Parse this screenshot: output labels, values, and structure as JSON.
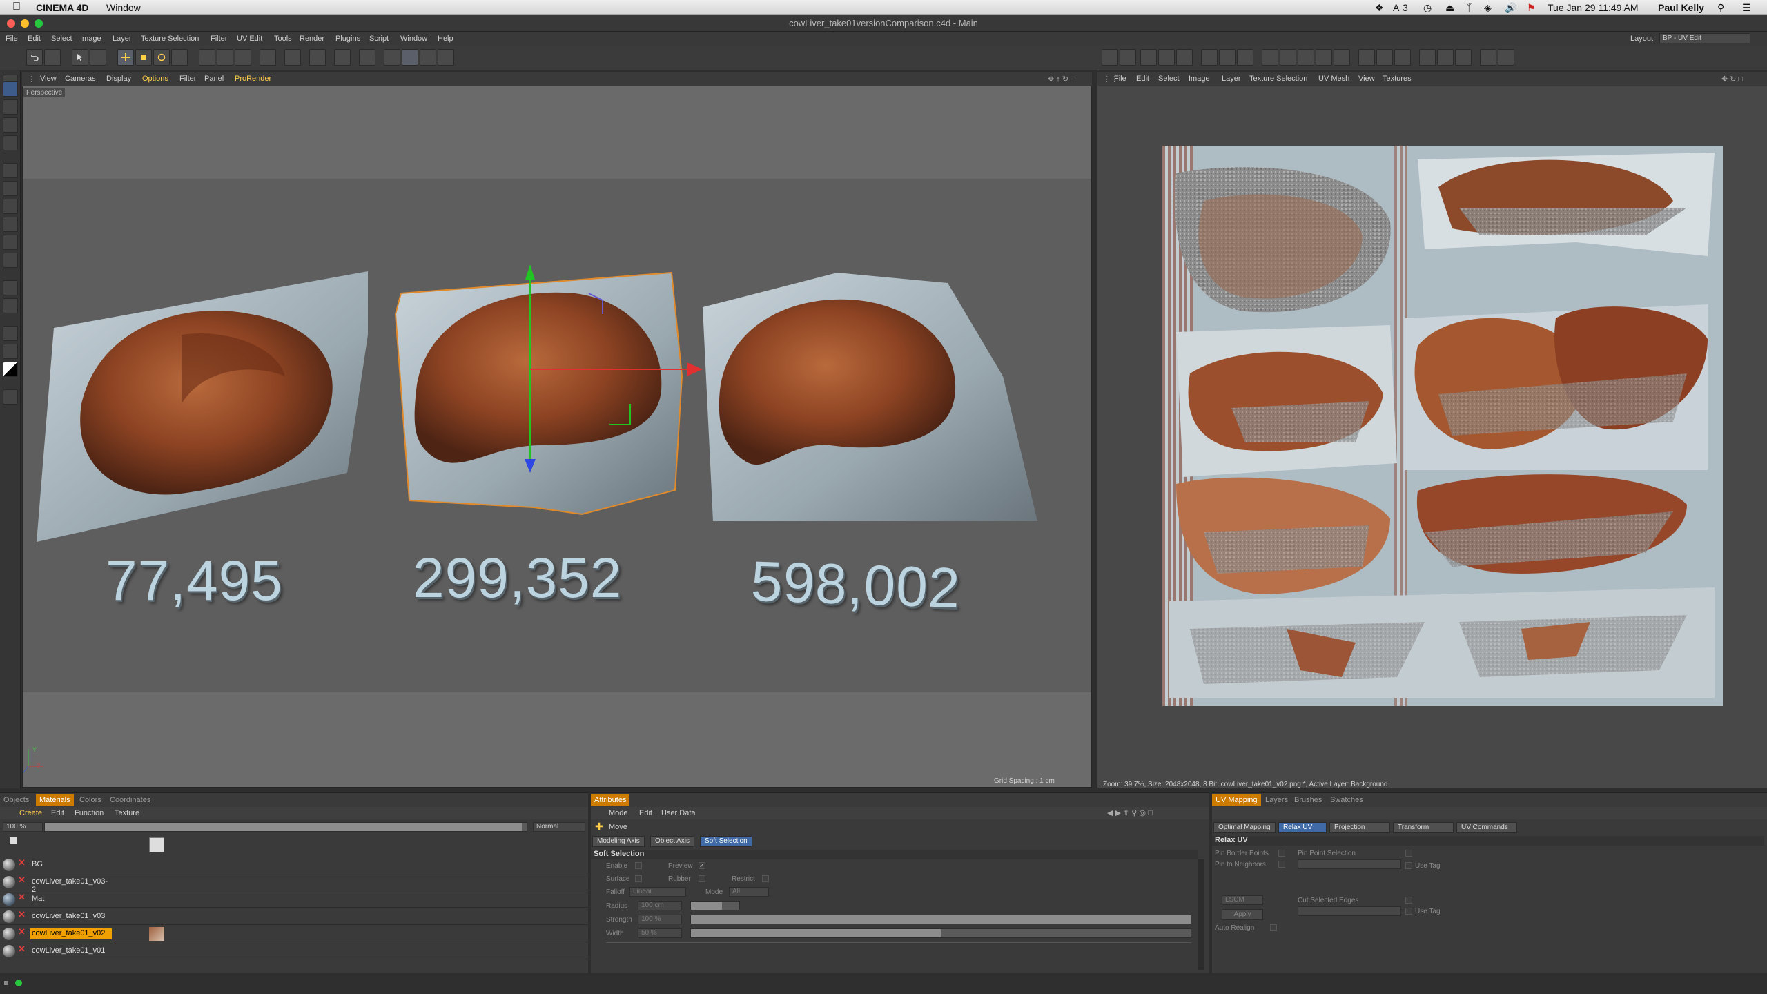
{
  "menubar": {
    "app": "CINEMA 4D",
    "window": "Window",
    "status_num": "3",
    "date_time": "Tue Jan 29  11:49 AM",
    "user": "Paul Kelly"
  },
  "titlebar": {
    "title": "cowLiver_take01versionComparison.c4d - Main"
  },
  "app_menu": [
    "File",
    "Edit",
    "Select",
    "Image",
    "Layer",
    "Texture Selection",
    "Filter",
    "UV Edit",
    "Tools",
    "Render",
    "Plugins",
    "Script",
    "Window",
    "Help"
  ],
  "layout": {
    "label": "Layout:",
    "value": "BP - UV Edit"
  },
  "viewport": {
    "menu": [
      "View",
      "Cameras",
      "Display",
      "Options",
      "Filter",
      "Panel",
      "ProRender"
    ],
    "label": "Perspective",
    "counts": [
      "77,495",
      "299,352",
      "598,002"
    ],
    "grid_spacing": "Grid Spacing : 1 cm",
    "axis_y": "Y",
    "axis_z": "Z"
  },
  "uv_view": {
    "menu": [
      "File",
      "Edit",
      "Select",
      "Image",
      "Layer",
      "Texture Selection",
      "UV Mesh",
      "View",
      "Textures"
    ],
    "status": "Zoom: 39.7%, Size: 2048x2048, 8 Bit, cowLiver_take01_v02.png *, Active Layer: Background"
  },
  "materials_panel": {
    "tabs": [
      "Objects",
      "Materials",
      "Colors",
      "Coordinates"
    ],
    "menu": [
      "Create",
      "Edit",
      "Function",
      "Texture"
    ],
    "zoom": "100 %",
    "blend_mode": "Normal",
    "items": [
      {
        "name": "BG",
        "selected": false
      },
      {
        "name": "cowLiver_take01_v03-2",
        "selected": false
      },
      {
        "name": "Mat",
        "selected": false
      },
      {
        "name": "cowLiver_take01_v03",
        "selected": false
      },
      {
        "name": "cowLiver_take01_v02",
        "selected": true
      },
      {
        "name": "cowLiver_take01_v01",
        "selected": false
      }
    ]
  },
  "attributes": {
    "tab": "Attributes",
    "menu": [
      "Mode",
      "Edit",
      "User Data"
    ],
    "tool": "Move",
    "subtabs": [
      "Modeling Axis",
      "Object Axis",
      "Soft Selection"
    ],
    "section": "Soft Selection",
    "enable": "Enable",
    "preview": "Preview",
    "surface": "Surface",
    "rubber": "Rubber",
    "restrict": "Restrict",
    "falloff_label": "Falloff",
    "falloff_value": "Linear",
    "mode_label": "Mode",
    "mode_value": "All",
    "radius_label": "Radius",
    "radius_value": "100 cm",
    "radius_fraction": 0.08,
    "strength_label": "Strength",
    "strength_value": "100 %",
    "strength_fraction": 1.0,
    "width_label": "Width",
    "width_value": "50 %",
    "width_fraction": 0.5
  },
  "uv_mapping": {
    "tabs": [
      "UV Mapping",
      "Layers",
      "Brushes",
      "Swatches"
    ],
    "subtabs": [
      "Optimal Mapping",
      "Relax UV",
      "Projection",
      "Transform",
      "UV Commands"
    ],
    "section": "Relax UV",
    "pin_border": "Pin Border Points",
    "pin_neighbors": "Pin to Neighbors",
    "pin_point_selection": "Pin Point Selection",
    "use_tag_1": "Use Tag",
    "method": "LSCM",
    "cut_edges": "Cut Selected Edges",
    "use_tag_2": "Use Tag",
    "apply": "Apply",
    "auto_realign": "Auto Realign"
  },
  "colors": {
    "accent_orange": "#cc7a00",
    "accent_blue": "#3f6aa5",
    "axis_green": "#22c422",
    "axis_red": "#e23030",
    "axis_blue": "#2d47e0",
    "selection_outline": "#e08a2c"
  }
}
